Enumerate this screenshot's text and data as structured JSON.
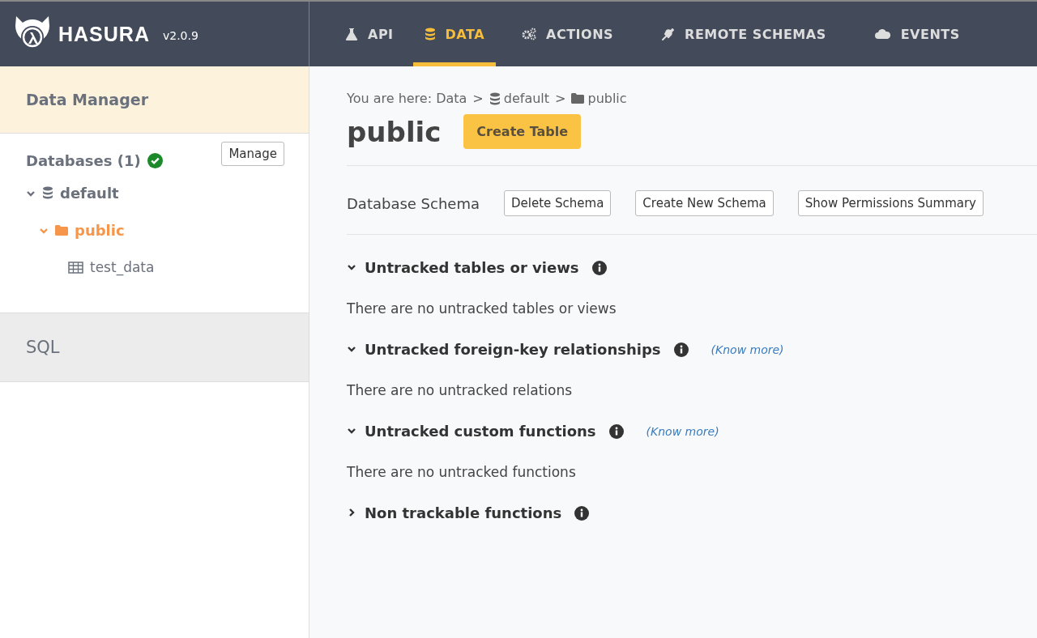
{
  "header": {
    "brand": "HASURA",
    "version": "v2.0.9",
    "tabs": [
      {
        "label": "API",
        "kind": "api",
        "selected": false
      },
      {
        "label": "DATA",
        "kind": "data",
        "selected": true
      },
      {
        "label": "ACTIONS",
        "kind": "actions",
        "selected": false
      },
      {
        "label": "REMOTE SCHEMAS",
        "kind": "remote",
        "selected": false
      },
      {
        "label": "EVENTS",
        "kind": "events",
        "selected": false
      }
    ]
  },
  "sidebar": {
    "title": "Data Manager",
    "databases_label": "Databases (1)",
    "databases_ok": true,
    "manage_button": "Manage",
    "tree": [
      {
        "label": "default",
        "kind": "database",
        "expanded": true,
        "selected": false,
        "children": [
          {
            "label": "public",
            "kind": "schema",
            "expanded": true,
            "selected": true,
            "children": [
              {
                "label": "test_data",
                "kind": "table",
                "selected": false
              }
            ]
          }
        ]
      }
    ],
    "sql_item": "SQL"
  },
  "breadcrumb": [
    {
      "label": "You are here: Data",
      "kind": "text"
    },
    {
      "label": ">",
      "kind": "separator"
    },
    {
      "label": "default",
      "kind": "database"
    },
    {
      "label": ">",
      "kind": "separator"
    },
    {
      "label": "public",
      "kind": "schema"
    }
  ],
  "page_title": "public",
  "create_button": "Create Table",
  "schema_row": {
    "label": "Database Schema",
    "buttons": [
      "Delete Schema",
      "Create New Schema",
      "Show Permissions Summary"
    ]
  },
  "sections": [
    {
      "title": "Untracked tables or views",
      "expanded": true,
      "message": "There are no untracked tables or views"
    },
    {
      "title": "Untracked foreign-key relationships",
      "expanded": true,
      "link": "(Know more)",
      "message": "There are no untracked relations"
    },
    {
      "title": "Untracked custom functions",
      "expanded": true,
      "link": "(Know more)",
      "message": "There are no untracked functions"
    },
    {
      "title": "Non trackable functions",
      "expanded": false
    }
  ]
}
